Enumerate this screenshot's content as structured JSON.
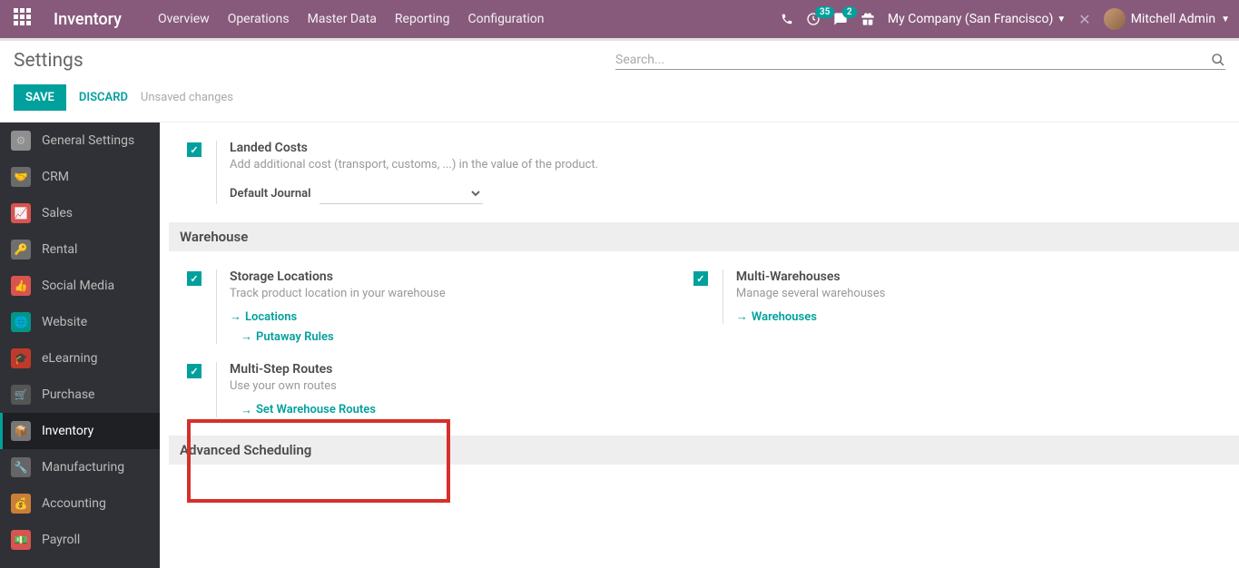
{
  "app_title": "Inventory",
  "nav": [
    "Overview",
    "Operations",
    "Master Data",
    "Reporting",
    "Configuration"
  ],
  "badges": {
    "activity": "35",
    "messages": "2"
  },
  "company": "My Company (San Francisco)",
  "user": "Mitchell Admin",
  "page_title": "Settings",
  "search_placeholder": "Search...",
  "buttons": {
    "save": "SAVE",
    "discard": "DISCARD"
  },
  "unsaved": "Unsaved changes",
  "sidebar": {
    "items": [
      {
        "label": "General Settings"
      },
      {
        "label": "CRM"
      },
      {
        "label": "Sales"
      },
      {
        "label": "Rental"
      },
      {
        "label": "Social Media"
      },
      {
        "label": "Website"
      },
      {
        "label": "eLearning"
      },
      {
        "label": "Purchase"
      },
      {
        "label": "Inventory"
      },
      {
        "label": "Manufacturing"
      },
      {
        "label": "Accounting"
      },
      {
        "label": "Payroll"
      }
    ]
  },
  "settings": {
    "landed": {
      "title": "Landed Costs",
      "desc": "Add additional cost (transport, customs, ...) in the value of the product.",
      "journal_label": "Default Journal"
    },
    "warehouse_header": "Warehouse",
    "storage": {
      "title": "Storage Locations",
      "desc": "Track product location in your warehouse",
      "link1": "Locations",
      "link2": "Putaway Rules"
    },
    "multi_wh": {
      "title": "Multi-Warehouses",
      "desc": "Manage several warehouses",
      "link": "Warehouses"
    },
    "routes": {
      "title": "Multi-Step Routes",
      "desc": "Use your own routes",
      "link": "Set Warehouse Routes"
    },
    "advanced_header": "Advanced Scheduling"
  }
}
